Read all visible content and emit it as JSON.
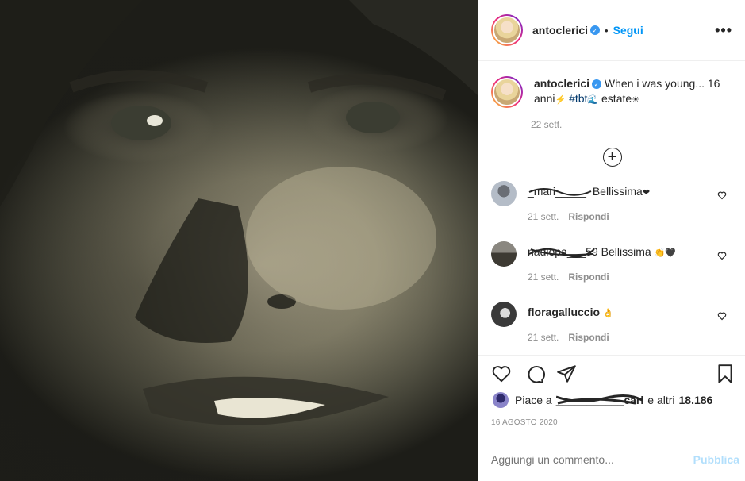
{
  "post": {
    "username": "antoclerici",
    "verified_badge": "✓",
    "dot": "•",
    "follow_label": "Segui",
    "more_label": "•••"
  },
  "caption": {
    "username": "antoclerici",
    "text_before": "When i was young... 16 anni",
    "glyph_1": "⚡",
    "hashtag": "#tbt",
    "glyph_2": "🌊",
    "text_after": " estate",
    "glyph_3": "☀",
    "time": "22 sett."
  },
  "comments": [
    {
      "username": "_mari_____",
      "text": "Bellissima",
      "emoji": "❤",
      "time": "21 sett.",
      "reply": "Rispondi"
    },
    {
      "username": "nadiopa___59",
      "text": "Bellissima",
      "emoji": "👏🖤",
      "time": "21 sett.",
      "reply": "Rispondi"
    },
    {
      "username": "floragalluccio",
      "text": "",
      "emoji": "👌",
      "time": "21 sett.",
      "reply": "Rispondi"
    }
  ],
  "likes": {
    "prefix": "Piace a",
    "hidden_user": "___________carl",
    "suffix": "e altri",
    "count": "18.186"
  },
  "date": "16 agosto 2020",
  "add_comment": {
    "placeholder": "Aggiungi un commento...",
    "post_label": "Pubblica"
  },
  "icons": {
    "heart": "heart-icon",
    "comment": "comment-icon",
    "share": "share-icon",
    "save": "bookmark-icon",
    "add": "plus-circle-icon"
  },
  "colors": {
    "link": "#0095f6",
    "verified": "#3897f0",
    "muted": "#8e8e8e",
    "text": "#262626",
    "post_disabled": "#b2dffc"
  }
}
